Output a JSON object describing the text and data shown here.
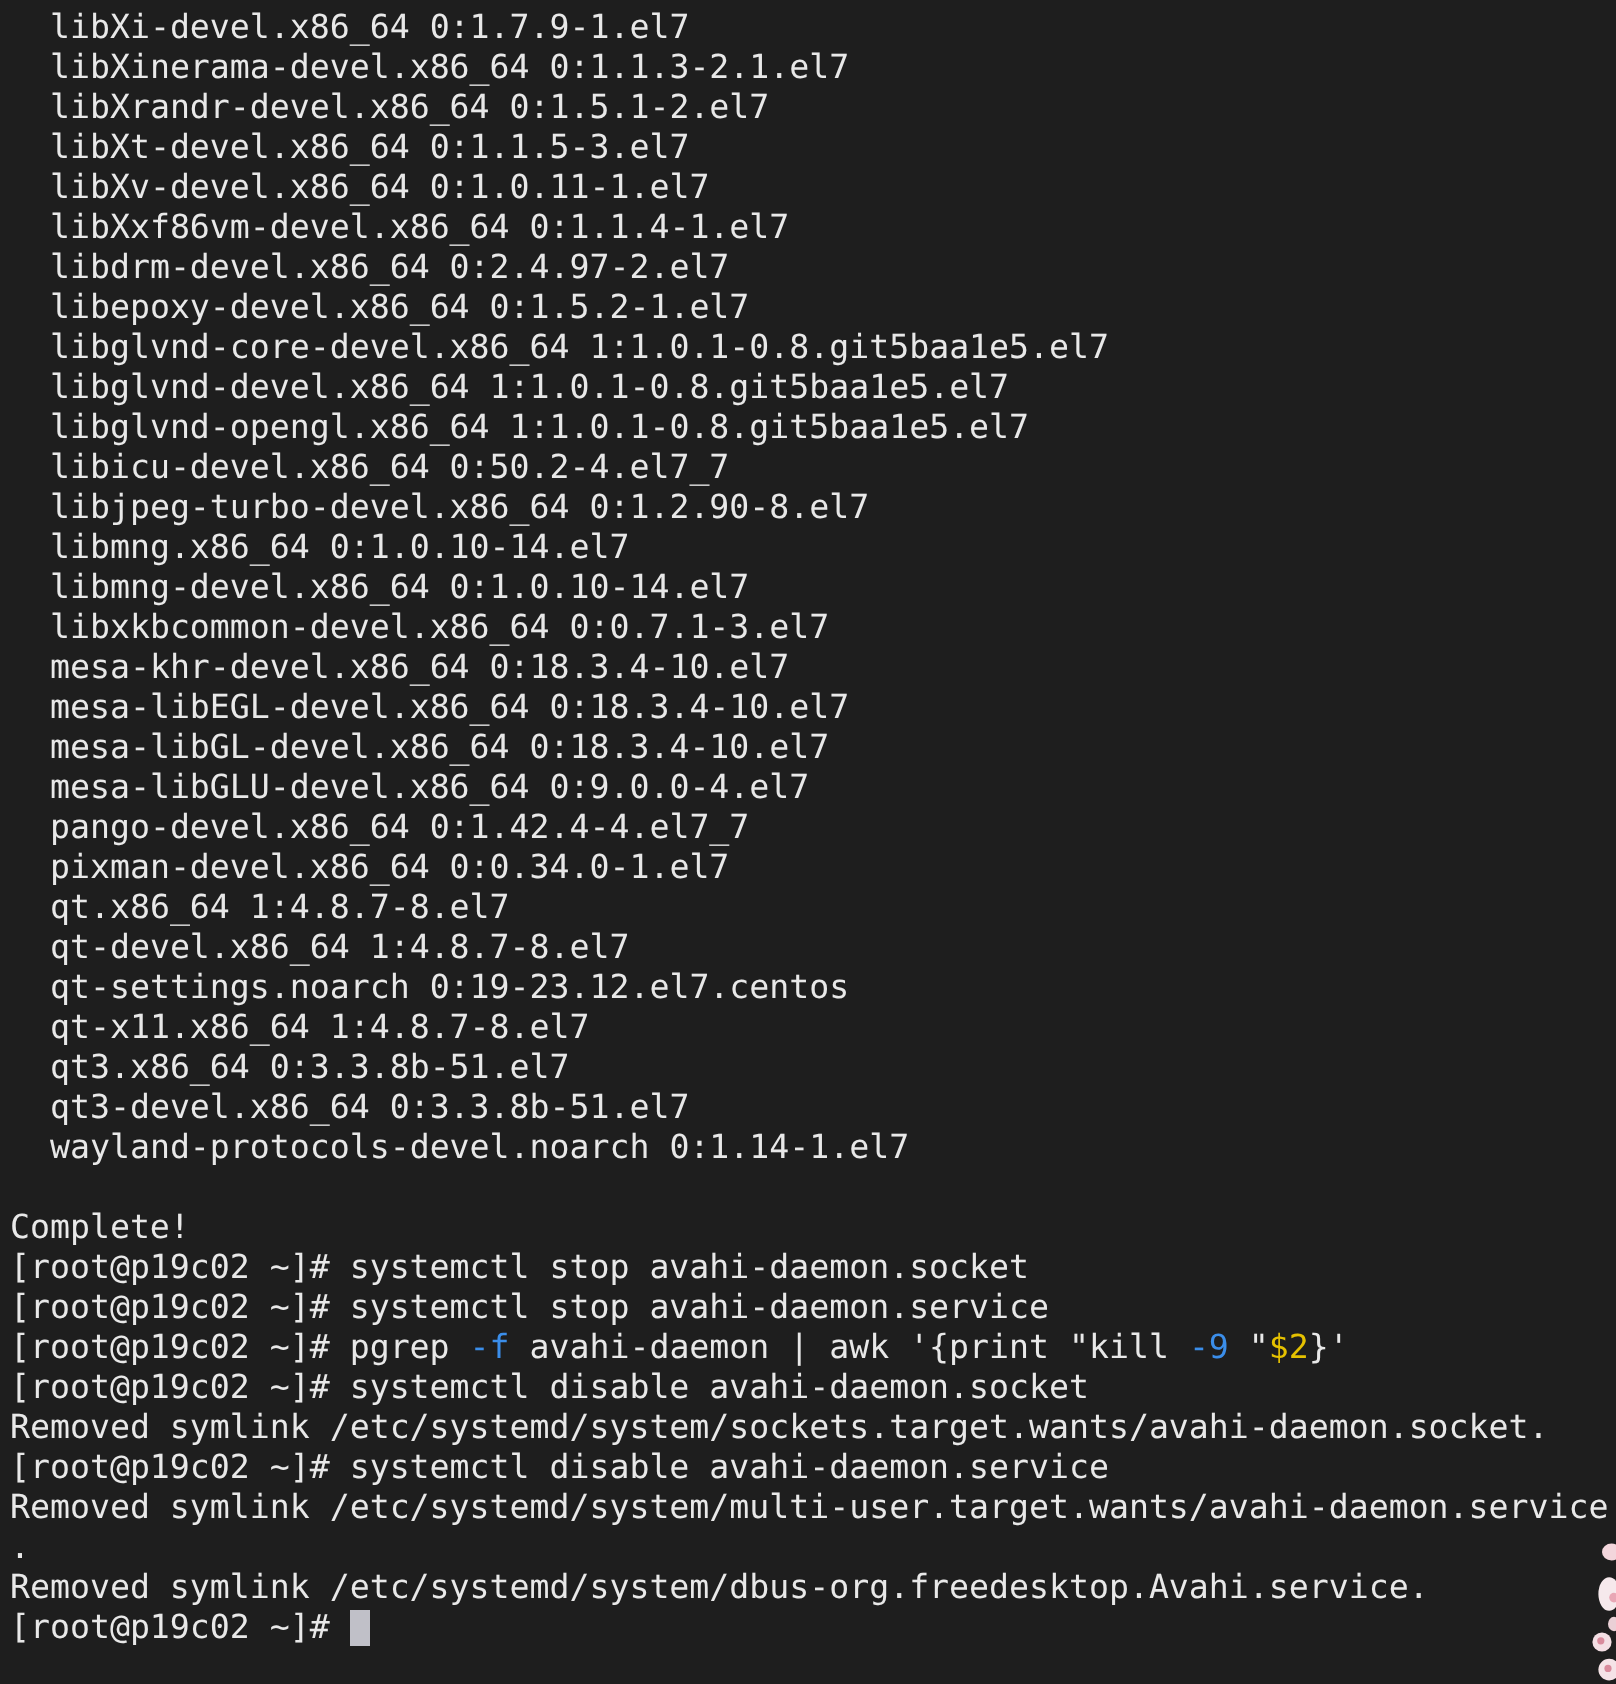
{
  "terminal": {
    "packages": [
      "libXi-devel.x86_64 0:1.7.9-1.el7",
      "libXinerama-devel.x86_64 0:1.1.3-2.1.el7",
      "libXrandr-devel.x86_64 0:1.5.1-2.el7",
      "libXt-devel.x86_64 0:1.1.5-3.el7",
      "libXv-devel.x86_64 0:1.0.11-1.el7",
      "libXxf86vm-devel.x86_64 0:1.1.4-1.el7",
      "libdrm-devel.x86_64 0:2.4.97-2.el7",
      "libepoxy-devel.x86_64 0:1.5.2-1.el7",
      "libglvnd-core-devel.x86_64 1:1.0.1-0.8.git5baa1e5.el7",
      "libglvnd-devel.x86_64 1:1.0.1-0.8.git5baa1e5.el7",
      "libglvnd-opengl.x86_64 1:1.0.1-0.8.git5baa1e5.el7",
      "libicu-devel.x86_64 0:50.2-4.el7_7",
      "libjpeg-turbo-devel.x86_64 0:1.2.90-8.el7",
      "libmng.x86_64 0:1.0.10-14.el7",
      "libmng-devel.x86_64 0:1.0.10-14.el7",
      "libxkbcommon-devel.x86_64 0:0.7.1-3.el7",
      "mesa-khr-devel.x86_64 0:18.3.4-10.el7",
      "mesa-libEGL-devel.x86_64 0:18.3.4-10.el7",
      "mesa-libGL-devel.x86_64 0:18.3.4-10.el7",
      "mesa-libGLU-devel.x86_64 0:9.0.0-4.el7",
      "pango-devel.x86_64 0:1.42.4-4.el7_7",
      "pixman-devel.x86_64 0:0.34.0-1.el7",
      "qt.x86_64 1:4.8.7-8.el7",
      "qt-devel.x86_64 1:4.8.7-8.el7",
      "qt-settings.noarch 0:19-23.12.el7.centos",
      "qt-x11.x86_64 1:4.8.7-8.el7",
      "qt3.x86_64 0:3.3.8b-51.el7",
      "qt3-devel.x86_64 0:3.3.8b-51.el7",
      "wayland-protocols-devel.noarch 0:1.14-1.el7"
    ],
    "lines": [
      {
        "segments": [
          {
            "text": "Complete!"
          }
        ]
      },
      {
        "segments": [
          {
            "text": "[root@p19c02 ~]# systemctl stop avahi-daemon.socket"
          }
        ]
      },
      {
        "segments": [
          {
            "text": "[root@p19c02 ~]# systemctl stop avahi-daemon.service"
          }
        ]
      },
      {
        "segments": [
          {
            "text": "[root@p19c02 ~]# pgrep "
          },
          {
            "text": "-f",
            "color": "#3b8eea"
          },
          {
            "text": " avahi-daemon | awk '{print \"kill "
          },
          {
            "text": "-9",
            "color": "#3b8eea"
          },
          {
            "text": " \""
          },
          {
            "text": "$2",
            "color": "#e5c100"
          },
          {
            "text": "}'"
          }
        ]
      },
      {
        "segments": [
          {
            "text": "[root@p19c02 ~]# systemctl disable avahi-daemon.socket"
          }
        ]
      },
      {
        "segments": [
          {
            "text": "Removed symlink /etc/systemd/system/sockets.target.wants/avahi-daemon.socket."
          }
        ]
      },
      {
        "segments": [
          {
            "text": "[root@p19c02 ~]# systemctl disable avahi-daemon.service"
          }
        ]
      },
      {
        "segments": [
          {
            "text": "Removed symlink /etc/systemd/system/multi-user.target.wants/avahi-daemon.service"
          }
        ]
      },
      {
        "segments": [
          {
            "text": "."
          }
        ]
      },
      {
        "segments": [
          {
            "text": "Removed symlink /etc/systemd/system/dbus-org.freedesktop.Avahi.service."
          }
        ]
      },
      {
        "segments": [
          {
            "text": "[root@p19c02 ~]#"
          }
        ],
        "cursor": true
      }
    ]
  }
}
